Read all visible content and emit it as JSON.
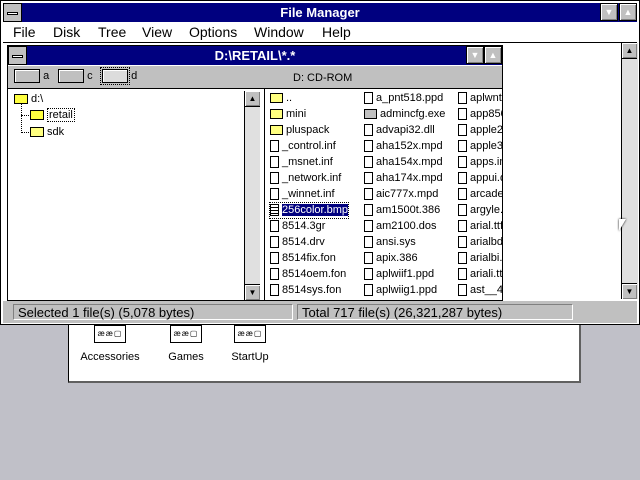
{
  "app": {
    "title": "File Manager"
  },
  "menu": [
    "File",
    "Disk",
    "Tree",
    "View",
    "Options",
    "Window",
    "Help"
  ],
  "child": {
    "title": "D:\\RETAIL\\*.*"
  },
  "drives": [
    {
      "letter": "a",
      "selected": false
    },
    {
      "letter": "c",
      "selected": false
    },
    {
      "letter": "d",
      "selected": true
    }
  ],
  "drive_label": "D: CD-ROM",
  "tree": [
    {
      "label": "d:\\",
      "open": true
    },
    {
      "label": "retail",
      "open": true,
      "selected": true
    },
    {
      "label": "sdk",
      "open": false
    }
  ],
  "files": {
    "col1": [
      "..",
      "mini",
      "pluspack",
      "_control.inf",
      "_msnet.inf",
      "_network.inf",
      "_winnet.inf",
      "256color.bmp",
      "8514.3gr",
      "8514.drv",
      "8514fix.fon",
      "8514oem.fon",
      "8514sys.fon"
    ],
    "col2": [
      "a_pnt518.ppd",
      "admincfg.exe",
      "advapi32.dll",
      "aha152x.mpd",
      "aha154x.mpd",
      "aha174x.mpd",
      "aic777x.mpd",
      "am1500t.386",
      "am2100.dos",
      "ansi.sys",
      "apix.386",
      "aplwiif1.ppd",
      "aplwiig1.ppd"
    ],
    "col3": [
      "aplwnt",
      "app850",
      "apple2",
      "apple3",
      "apps.in",
      "appui.d",
      "arcade",
      "argyle.",
      "arial.ttf",
      "arialbd",
      "arialbi.",
      "ariali.tt",
      "ast__4"
    ],
    "selected": "256color.bmp"
  },
  "status": {
    "selected": "Selected 1 file(s) (5,078 bytes)",
    "total": "Total 717 file(s) (26,321,287 bytes)"
  },
  "groups": [
    "Accessories",
    "Games",
    "StartUp"
  ]
}
